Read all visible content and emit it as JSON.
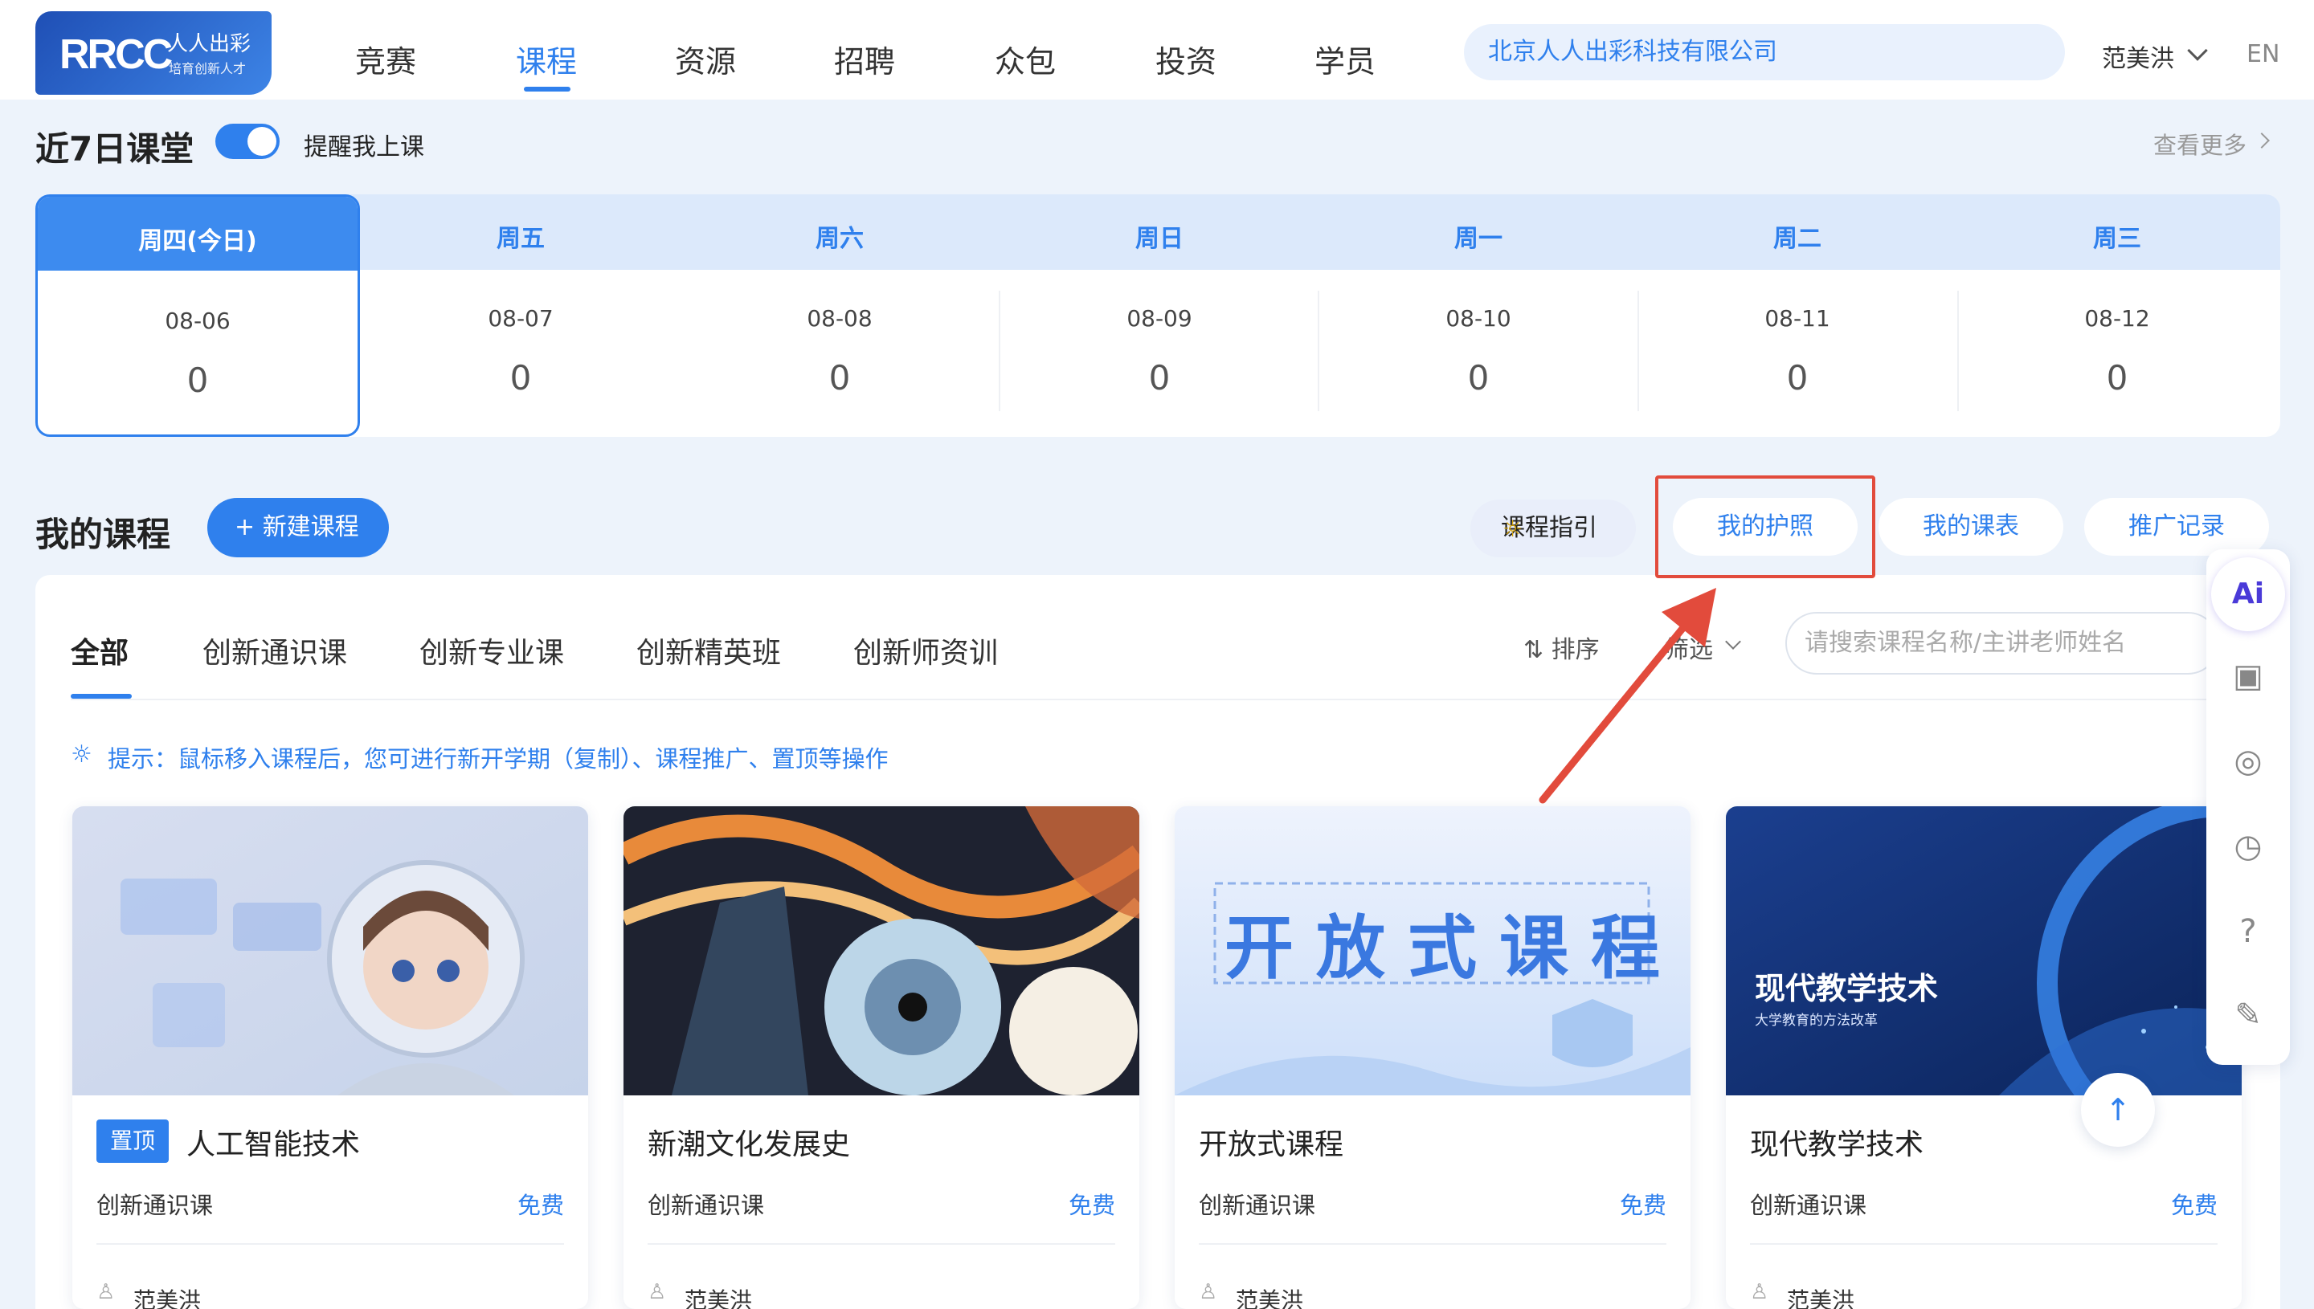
{
  "header": {
    "logo_text": "RRCC",
    "logo_cn": "人人出彩",
    "logo_slogan": "培育创新人才",
    "nav": [
      "竞赛",
      "课程",
      "资源",
      "招聘",
      "众包",
      "投资",
      "学员"
    ],
    "active_nav": "课程",
    "organization": "北京人人出彩科技有限公司",
    "user_name": "范美洪",
    "language": "EN"
  },
  "week": {
    "title": "近7日课堂",
    "toggle_label": "提醒我上课",
    "toggle_on": true,
    "view_more": "查看更多",
    "days": [
      {
        "label": "周四(今日)",
        "date": "08-06",
        "count": "0"
      },
      {
        "label": "周五",
        "date": "08-07",
        "count": "0"
      },
      {
        "label": "周六",
        "date": "08-08",
        "count": "0"
      },
      {
        "label": "周日",
        "date": "08-09",
        "count": "0"
      },
      {
        "label": "周一",
        "date": "08-10",
        "count": "0"
      },
      {
        "label": "周二",
        "date": "08-11",
        "count": "0"
      },
      {
        "label": "周三",
        "date": "08-12",
        "count": "0"
      }
    ]
  },
  "courses": {
    "title": "我的课程",
    "new_button": "新建课程",
    "guide_button": "课程指引",
    "passport_button": "我的护照",
    "schedule_button": "我的课表",
    "promo_button": "推广记录",
    "tabs": [
      "全部",
      "创新通识课",
      "创新专业课",
      "创新精英班",
      "创新师资训"
    ],
    "sort_label": "排序",
    "filter_label": "筛选",
    "search_placeholder": "请搜索课程名称/主讲老师姓名",
    "hint": "提示：鼠标移入课程后，您可进行新开学期（复制）、课程推广、置顶等操作",
    "cards": [
      {
        "title": "人工智能技术",
        "pinned": "置顶",
        "category": "创新通识课",
        "price": "免费",
        "teacher": "范美洪",
        "cover_title": "",
        "cover_sub": ""
      },
      {
        "title": "新潮文化发展史",
        "category": "创新通识课",
        "price": "免费",
        "teacher": "范美洪",
        "cover_title": "",
        "cover_sub": ""
      },
      {
        "title": "开放式课程",
        "category": "创新通识课",
        "price": "免费",
        "teacher": "范美洪",
        "cover_title": "开放式课程",
        "cover_sub": ""
      },
      {
        "title": "现代教学技术",
        "category": "创新通识课",
        "price": "免费",
        "teacher": "范美洪",
        "cover_title": "现代教学技术",
        "cover_sub": "大学教育的方法改革"
      }
    ]
  },
  "rail": {
    "ai_label": "Ai",
    "icons": [
      "ai-icon",
      "id-card-icon",
      "chat-icon",
      "timer-icon",
      "help-icon",
      "edit-icon"
    ]
  },
  "colors": {
    "accent": "#2f80ed",
    "highlight": "#e24b3c",
    "page_bg": "#edf3fb"
  }
}
